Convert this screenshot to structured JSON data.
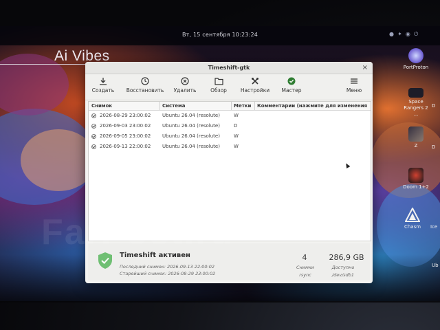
{
  "topbar": {
    "clock": "Вт, 15 сентября  10:23:24"
  },
  "desktop": {
    "brand": "Ai Vibes",
    "icons": [
      {
        "label": "PortProton",
        "icon": "portproton-icon"
      },
      {
        "label": "Space Rangers 2 ...",
        "icon": "space-rangers-icon"
      },
      {
        "label": "Z",
        "icon": "z-game-icon"
      },
      {
        "label": "Doom 1+2",
        "icon": "doom-icon"
      },
      {
        "label": "Chasm",
        "icon": "chasm-icon"
      }
    ],
    "edge_labels": [
      "D",
      "D",
      "Ice",
      "Ub"
    ]
  },
  "window": {
    "title": "Timeshift-gtk",
    "close_glyph": "×"
  },
  "toolbar": {
    "create": "Создать",
    "restore": "Восстановить",
    "delete": "Удалить",
    "browse": "Обзор",
    "settings": "Настройки",
    "wizard": "Мастер",
    "menu": "Меню"
  },
  "table": {
    "columns": [
      "Снимок",
      "Система",
      "Метки",
      "Комментарии (нажмите для изменения"
    ],
    "rows": [
      {
        "snapshot": "2026-08-29 23:00:02",
        "system": "Ubuntu 26.04 (resolute)",
        "tag": "W"
      },
      {
        "snapshot": "2026-09-03 23:00:02",
        "system": "Ubuntu 26.04 (resolute)",
        "tag": "D"
      },
      {
        "snapshot": "2026-09-05 23:00:02",
        "system": "Ubuntu 26.04 (resolute)",
        "tag": "W"
      },
      {
        "snapshot": "2026-09-13 22:00:02",
        "system": "Ubuntu 26.04 (resolute)",
        "tag": "W"
      }
    ]
  },
  "status": {
    "title": "Timeshift активен",
    "latest": "Последний снимок: 2026-09-13 22:00:02",
    "oldest": "Старейший снимок: 2026-08-29 23:00:02",
    "snapshots_count": "4",
    "snapshots_label": "Снимки",
    "snapshots_sub": "rsync",
    "free_space": "286,9 GB",
    "free_label": "Доступно",
    "free_sub": "/dev/sdb1"
  },
  "watermark": "FarPost.ru",
  "colors": {
    "window_bg": "#f3f3f1",
    "shield": "#6fbf73"
  }
}
